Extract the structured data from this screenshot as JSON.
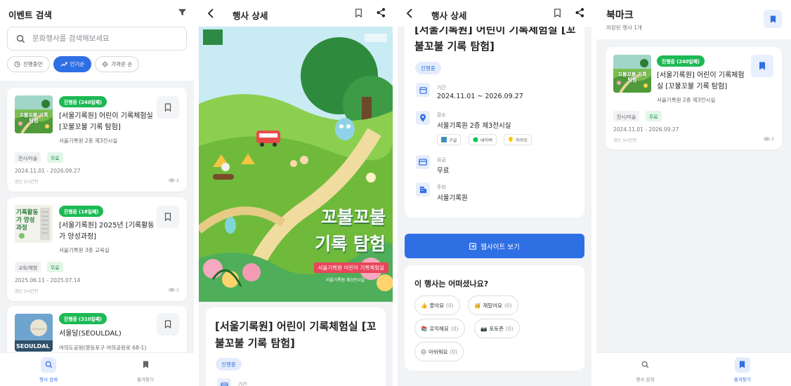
{
  "search_screen": {
    "title": "이벤트 검색",
    "search_placeholder": "문화행사를 검색해보세요",
    "filters": [
      {
        "label": "진행중만",
        "icon": "clock-icon",
        "active": false
      },
      {
        "label": "인기순",
        "icon": "trend-icon",
        "active": true
      },
      {
        "label": "가까운 순",
        "icon": "location-icon",
        "active": false
      }
    ],
    "events": [
      {
        "status": "진행중 (240일째)",
        "title_line1": "[서울기록원] 어린이 기록체험실",
        "title_line2": "[꼬불꼬불 기록 탐험]",
        "place": "서울기록원 2층 제3전시실",
        "category": "전시/미술",
        "fee": "무료",
        "date": "2024.11.01 - 2026.09.27",
        "updated": "갱신 3시간전",
        "views": "2"
      },
      {
        "status": "진행중 (18일째)",
        "title_line1": "[서울기록원] 2025년 [기록활동",
        "title_line2": "가 양성과정]",
        "place": "서울기록원 3층 교육실",
        "category": "교육/체험",
        "fee": "무료",
        "date": "2025.06.11 - 2025.07.14",
        "updated": "갱신 3시간전",
        "views": "2"
      },
      {
        "status": "진행중 (310일째)",
        "title_line1": "서울달(SEOULDAL)",
        "title_line2": "",
        "place": "여의도공원(영등포구 여의공원로 68-1)"
      }
    ]
  },
  "nav": {
    "search": "행사 검색",
    "bookmarks": "즐겨찾기"
  },
  "detail": {
    "title": "행사 상세",
    "poster": {
      "line1": "꼬불꼬불",
      "line2": "기록 탐험",
      "banner": "서울기록원 어린이 기록체험실",
      "sub": "서울기록원 제3전시실"
    },
    "event_title_line1": "[서울기록원] 어린이 기록체험실 [꼬",
    "event_title_line2": "불꼬불 기록 탐험]",
    "status": "진행중",
    "period_label": "기간",
    "period_value": "2024.11.01 ~ 2026.09.27",
    "place_label": "장소",
    "place_value": "서울기록원 2층 제3전시실",
    "map_buttons": [
      "구글",
      "네이버",
      "카카오"
    ],
    "fee_label": "요금",
    "fee_value": "무료",
    "host_label": "주최",
    "host_value": "서울기록원",
    "website_button": "웹사이트 보기",
    "reaction_title": "이 행사는 어떠셨나요?",
    "reactions": [
      {
        "emoji": "👍",
        "label": "좋아요",
        "count": "(0)"
      },
      {
        "emoji": "🥳",
        "label": "재밌어요",
        "count": "(0)"
      },
      {
        "emoji": "📚",
        "label": "유익해요",
        "count": "(0)"
      },
      {
        "emoji": "📷",
        "label": "포토존",
        "count": "(0)"
      },
      {
        "emoji": "😐",
        "label": "아쉬워요",
        "count": "(0)"
      }
    ]
  },
  "bookmarks": {
    "title": "북마크",
    "subtitle": "저장된 행사 1개",
    "item": {
      "status": "진행중 (240일째)",
      "title_line1": "[서울기록원] 어린이 기록체험",
      "title_line2": "실 [꼬불꼬불 기록 탐험]",
      "place": "서울기록원 2층 제3전시실",
      "category": "전시/미술",
      "fee": "무료",
      "date": "2024.11.01 - 2026.09.27",
      "updated": "갱신 3시간전",
      "views": "2"
    }
  },
  "thumb_texts": {
    "t1": "꼬불꼬불 기록 탐험",
    "t2": "기록활동가 양성과정",
    "t3": "SEOULDAL"
  },
  "colors": {
    "accent": "#2f6fe4",
    "status_green": "#1db954",
    "background": "#f2f3f5"
  }
}
